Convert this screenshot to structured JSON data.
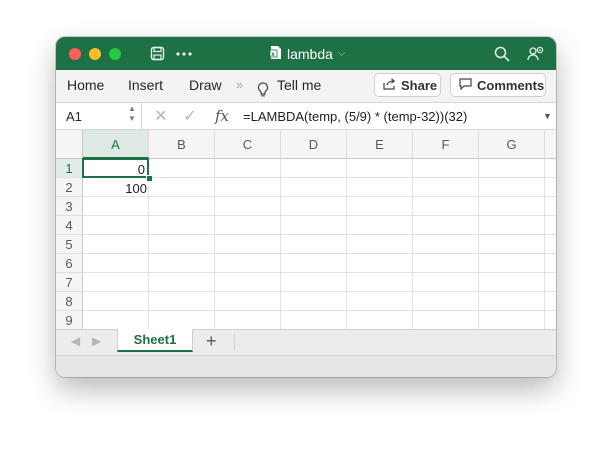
{
  "window": {
    "title": "lambda",
    "title_chevron": "⌵"
  },
  "ribbon": {
    "tabs": [
      "Home",
      "Insert",
      "Draw"
    ],
    "more_chevron": "»",
    "tell_me": "Tell me",
    "share_label": "Share",
    "comments_label": "Comments"
  },
  "formula_bar": {
    "name_box": "A1",
    "stepper": "▲\n▼",
    "cancel_icon": "✕",
    "enter_icon": "✓",
    "fx_label": "fx",
    "formula": "=LAMBDA(temp, (5/9) * (temp-32))(32)",
    "dropdown": "▼"
  },
  "grid": {
    "columns": [
      "A",
      "B",
      "C",
      "D",
      "E",
      "F",
      "G"
    ],
    "rows": [
      "1",
      "2",
      "3",
      "4",
      "5",
      "6",
      "7",
      "8",
      "9"
    ],
    "cells": {
      "A1": "0",
      "A2": "100"
    },
    "selected_cell": "A1"
  },
  "sheets": {
    "tabs": [
      "Sheet1"
    ],
    "active": "Sheet1",
    "add_label": "+",
    "prev_icon": "◀",
    "next_icon": "▶"
  },
  "colors": {
    "accent": "#1e7145",
    "title_text": "#ffffff"
  }
}
